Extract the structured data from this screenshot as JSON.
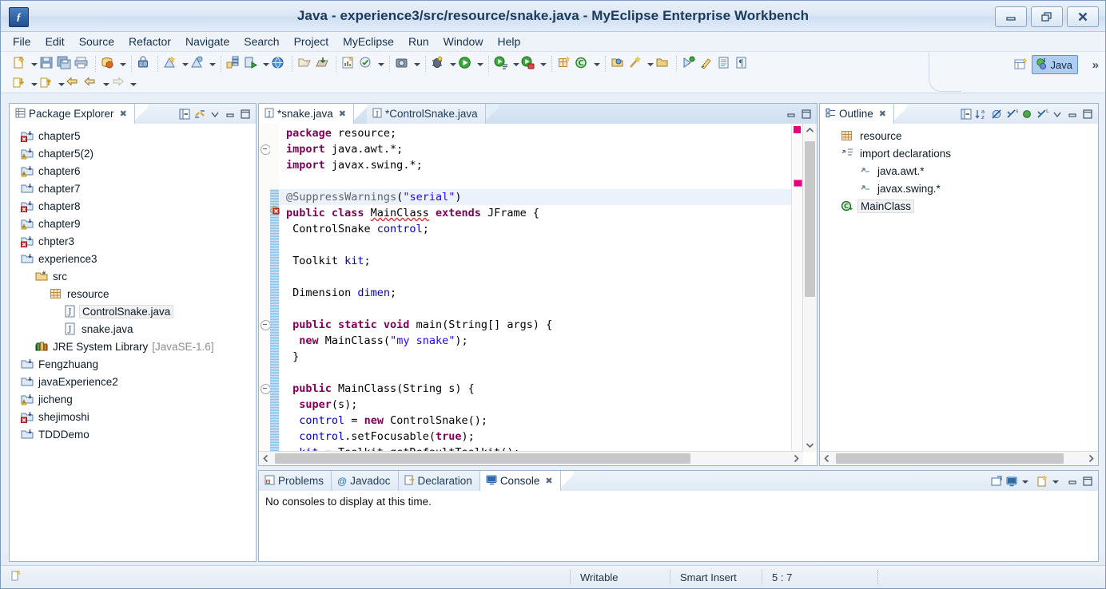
{
  "window": {
    "title": "Java - experience3/src/resource/snake.java - MyEclipse Enterprise Workbench",
    "app_icon": "myeclipse-icon",
    "minimize_label": "Minimize",
    "restore_label": "Restore",
    "close_label": "Close"
  },
  "menubar": {
    "items": [
      {
        "label": "File"
      },
      {
        "label": "Edit"
      },
      {
        "label": "Source"
      },
      {
        "label": "Refactor"
      },
      {
        "label": "Navigate"
      },
      {
        "label": "Search"
      },
      {
        "label": "Project"
      },
      {
        "label": "MyEclipse"
      },
      {
        "label": "Run"
      },
      {
        "label": "Window"
      },
      {
        "label": "Help"
      }
    ]
  },
  "toolbar": {
    "row1_groups": [
      {
        "icons": [
          "new-wizard-icon"
        ],
        "dropdown": true
      },
      {
        "icons": [
          "save-icon",
          "save-all-icon",
          "print-icon"
        ],
        "dropdown": false
      },
      {
        "icons": [
          "myeclipse-db-icon"
        ],
        "dropdown": true
      },
      {
        "icons": [
          "lock-calendar-icon"
        ],
        "dropdown": false
      },
      {
        "icons": [
          "deploy-icon"
        ],
        "dropdown": true,
        "icons2": [
          "deploy-alt-icon"
        ],
        "dropdown2": true
      },
      {
        "icons": [
          "server-stack-icon",
          "server-run-icon"
        ],
        "dropdown": true,
        "icons3": [
          "globe-icon"
        ]
      },
      {
        "icons": [
          "export-icon",
          "import-icon"
        ],
        "dropdown": false
      },
      {
        "icons": [
          "report-icon",
          "validate-icon"
        ],
        "dropdown": true
      },
      {
        "icons": [
          "snapshot-icon"
        ],
        "dropdown": true
      },
      {
        "icons": [
          "debug-icon"
        ],
        "dropdown": true,
        "icons4": [
          "run-icon"
        ],
        "dropdown4": true
      },
      {
        "icons": [
          "run-config-icon"
        ],
        "dropdown": true,
        "icons5": [
          "run-secure-icon"
        ],
        "dropdown5": true
      },
      {
        "icons": [
          "new-package-icon",
          "new-class-icon"
        ],
        "dropdown": true
      },
      {
        "icons": [
          "open-type-icon",
          "search-wand-icon"
        ],
        "dropdown": true,
        "icons6": [
          "open-resource-icon"
        ]
      },
      {
        "icons": [
          "next-annotation-icon",
          "brush-icon",
          "show-whitespace-icon",
          "paragraph-icon"
        ],
        "dropdown": false
      }
    ],
    "row2_groups": [
      {
        "icons": [
          "back-to-icon"
        ],
        "dropdown": true
      },
      {
        "icons": [
          "forward-to-icon"
        ],
        "dropdown": true
      },
      {
        "icons": [
          "prev-edit-icon",
          "back-icon"
        ],
        "dropdown": true
      },
      {
        "icons": [
          "forward-nav-icon"
        ],
        "dropdown": true
      }
    ],
    "perspective": {
      "open_perspective_icon": "open-perspective-icon",
      "active_label": "Java",
      "active_icon": "java-perspective-icon",
      "overflow_label": "»"
    }
  },
  "package_explorer": {
    "tab_label": "Package Explorer",
    "tab_icon": "package-explorer-icon",
    "close_icon": "close-icon",
    "tools": [
      {
        "name": "collapse-all-icon"
      },
      {
        "name": "link-with-editor-icon"
      },
      {
        "name": "view-menu-icon"
      },
      {
        "name": "minimize-icon"
      },
      {
        "name": "maximize-icon"
      }
    ],
    "tree": [
      {
        "label": "chapter5",
        "indent": 0,
        "icon": "java-project-error-icon"
      },
      {
        "label": "chapter5(2)",
        "indent": 0,
        "icon": "java-project-warning-icon"
      },
      {
        "label": "chapter6",
        "indent": 0,
        "icon": "java-project-warning-icon"
      },
      {
        "label": "chapter7",
        "indent": 0,
        "icon": "java-project-icon"
      },
      {
        "label": "chapter8",
        "indent": 0,
        "icon": "java-project-error-icon"
      },
      {
        "label": "chapter9",
        "indent": 0,
        "icon": "java-project-warning-icon"
      },
      {
        "label": "chpter3",
        "indent": 0,
        "icon": "java-project-error-icon"
      },
      {
        "label": "experience3",
        "indent": 0,
        "icon": "java-project-icon"
      },
      {
        "label": "src",
        "indent": 1,
        "icon": "source-folder-icon"
      },
      {
        "label": "resource",
        "indent": 2,
        "icon": "package-icon"
      },
      {
        "label": "ControlSnake.java",
        "indent": 3,
        "icon": "java-file-icon",
        "selected": true
      },
      {
        "label": "snake.java",
        "indent": 3,
        "icon": "java-file-icon"
      },
      {
        "label": "JRE System Library",
        "indent": 1,
        "icon": "library-icon",
        "suffix": "[JavaSE-1.6]"
      },
      {
        "label": "Fengzhuang",
        "indent": 0,
        "icon": "java-project-icon"
      },
      {
        "label": "javaExperience2",
        "indent": 0,
        "icon": "java-project-icon"
      },
      {
        "label": "jicheng",
        "indent": 0,
        "icon": "java-project-warning-icon"
      },
      {
        "label": "shejimoshi",
        "indent": 0,
        "icon": "java-project-error-icon"
      },
      {
        "label": "TDDDemo",
        "indent": 0,
        "icon": "java-project-icon"
      }
    ]
  },
  "editor": {
    "tabs": [
      {
        "label": "*snake.java",
        "icon": "java-file-icon",
        "active": true,
        "closeable": true
      },
      {
        "label": "*ControlSnake.java",
        "icon": "java-file-icon",
        "active": false,
        "closeable": false
      }
    ],
    "tools": [
      {
        "name": "minimize-icon"
      },
      {
        "name": "maximize-icon"
      }
    ],
    "lines": [
      {
        "n": 1,
        "fold": false,
        "hl": false,
        "change": false,
        "tokens": [
          {
            "t": "package",
            "c": "kw"
          },
          {
            "t": " resource;",
            "c": "plain"
          }
        ]
      },
      {
        "n": 2,
        "fold": true,
        "hl": false,
        "change": false,
        "tokens": [
          {
            "t": "import",
            "c": "kw"
          },
          {
            "t": " java.awt.*;",
            "c": "plain"
          }
        ]
      },
      {
        "n": 3,
        "fold": false,
        "hl": false,
        "change": false,
        "tokens": [
          {
            "t": "import",
            "c": "kw"
          },
          {
            "t": " javax.swing.*;",
            "c": "plain"
          }
        ]
      },
      {
        "n": 4,
        "fold": false,
        "hl": false,
        "change": false,
        "tokens": []
      },
      {
        "n": 5,
        "fold": false,
        "hl": true,
        "change": true,
        "tokens": [
          {
            "t": "@SuppressWarnings",
            "c": "ann"
          },
          {
            "t": "(",
            "c": "plain"
          },
          {
            "t": "\"serial\"",
            "c": "str"
          },
          {
            "t": ")",
            "c": "plain"
          }
        ]
      },
      {
        "n": 6,
        "fold": false,
        "hl": false,
        "change": true,
        "error": true,
        "tokens": [
          {
            "t": "public class ",
            "c": "kw"
          },
          {
            "t": "MainClass",
            "c": "sq"
          },
          {
            "t": " ",
            "c": "plain"
          },
          {
            "t": "extends",
            "c": "kw"
          },
          {
            "t": " JFrame {",
            "c": "plain"
          }
        ]
      },
      {
        "n": 7,
        "fold": false,
        "hl": false,
        "change": true,
        "tokens": [
          {
            "t": " ControlSnake ",
            "c": "plain"
          },
          {
            "t": "control",
            "c": "fld"
          },
          {
            "t": ";",
            "c": "plain"
          }
        ]
      },
      {
        "n": 8,
        "fold": false,
        "hl": false,
        "change": true,
        "tokens": []
      },
      {
        "n": 9,
        "fold": false,
        "hl": false,
        "change": true,
        "tokens": [
          {
            "t": " Toolkit ",
            "c": "plain"
          },
          {
            "t": "kit",
            "c": "fld"
          },
          {
            "t": ";",
            "c": "plain"
          }
        ]
      },
      {
        "n": 10,
        "fold": false,
        "hl": false,
        "change": true,
        "tokens": []
      },
      {
        "n": 11,
        "fold": false,
        "hl": false,
        "change": true,
        "tokens": [
          {
            "t": " Dimension ",
            "c": "plain"
          },
          {
            "t": "dimen",
            "c": "fld"
          },
          {
            "t": ";",
            "c": "plain"
          }
        ]
      },
      {
        "n": 12,
        "fold": false,
        "hl": false,
        "change": true,
        "tokens": []
      },
      {
        "n": 13,
        "fold": true,
        "hl": false,
        "change": true,
        "tokens": [
          {
            "t": " public static void ",
            "c": "kw"
          },
          {
            "t": "main(String[] args) {",
            "c": "plain"
          }
        ]
      },
      {
        "n": 14,
        "fold": false,
        "hl": false,
        "change": true,
        "tokens": [
          {
            "t": "  new ",
            "c": "kw"
          },
          {
            "t": "MainClass(",
            "c": "plain"
          },
          {
            "t": "\"my snake\"",
            "c": "str"
          },
          {
            "t": ");",
            "c": "plain"
          }
        ]
      },
      {
        "n": 15,
        "fold": false,
        "hl": false,
        "change": true,
        "tokens": [
          {
            "t": " }",
            "c": "plain"
          }
        ]
      },
      {
        "n": 16,
        "fold": false,
        "hl": false,
        "change": true,
        "tokens": []
      },
      {
        "n": 17,
        "fold": true,
        "hl": false,
        "change": true,
        "tokens": [
          {
            "t": " public ",
            "c": "kw"
          },
          {
            "t": "MainClass(String s) {",
            "c": "plain"
          }
        ]
      },
      {
        "n": 18,
        "fold": false,
        "hl": false,
        "change": true,
        "tokens": [
          {
            "t": "  super",
            "c": "kw"
          },
          {
            "t": "(s);",
            "c": "plain"
          }
        ]
      },
      {
        "n": 19,
        "fold": false,
        "hl": false,
        "change": true,
        "tokens": [
          {
            "t": "  ",
            "c": "plain"
          },
          {
            "t": "control",
            "c": "fld"
          },
          {
            "t": " = ",
            "c": "plain"
          },
          {
            "t": "new",
            "c": "kw"
          },
          {
            "t": " ControlSnake();",
            "c": "plain"
          }
        ]
      },
      {
        "n": 20,
        "fold": false,
        "hl": false,
        "change": true,
        "tokens": [
          {
            "t": "  ",
            "c": "plain"
          },
          {
            "t": "control",
            "c": "fld"
          },
          {
            "t": ".setFocusable(",
            "c": "plain"
          },
          {
            "t": "true",
            "c": "kw"
          },
          {
            "t": ");",
            "c": "plain"
          }
        ]
      },
      {
        "n": 21,
        "fold": false,
        "hl": false,
        "change": true,
        "clipped": true,
        "tokens": [
          {
            "t": "  ",
            "c": "plain"
          },
          {
            "t": "kit",
            "c": "fld"
          },
          {
            "t": " = Toolkit.",
            "c": "plain"
          },
          {
            "t": "getDefaultToolkit",
            "c": "plain"
          },
          {
            "t": "();",
            "c": "plain"
          }
        ]
      }
    ],
    "overview_markers": [
      {
        "name": "error-marker",
        "color": "#e6007e",
        "top_pct": 1
      },
      {
        "name": "error-marker",
        "color": "#e6007e",
        "top_pct": 17
      }
    ]
  },
  "outline": {
    "tab_label": "Outline",
    "tab_icon": "outline-icon",
    "close_icon": "close-icon",
    "tools": [
      {
        "name": "collapse-all-icon"
      },
      {
        "name": "sort-icon"
      },
      {
        "name": "hide-fields-icon"
      },
      {
        "name": "hide-static-icon"
      },
      {
        "name": "hide-nonpublic-icon"
      },
      {
        "name": "hide-local-types-icon"
      },
      {
        "name": "view-menu-icon"
      },
      {
        "name": "minimize-icon"
      },
      {
        "name": "maximize-icon"
      }
    ],
    "tree": [
      {
        "label": "resource",
        "indent": 0,
        "icon": "package-icon"
      },
      {
        "label": "import declarations",
        "indent": 0,
        "icon": "import-declarations-icon"
      },
      {
        "label": "java.awt.*",
        "indent": 1,
        "icon": "import-icon"
      },
      {
        "label": "javax.swing.*",
        "indent": 1,
        "icon": "import-icon"
      },
      {
        "label": "MainClass",
        "indent": 0,
        "icon": "class-icon",
        "selected": true
      }
    ]
  },
  "bottom_panel": {
    "tabs": [
      {
        "label": "Problems",
        "icon": "problems-icon",
        "active": false,
        "closeable": false
      },
      {
        "label": "Javadoc",
        "icon": "javadoc-icon",
        "active": false,
        "closeable": false
      },
      {
        "label": "Declaration",
        "icon": "declaration-icon",
        "active": false,
        "closeable": false
      },
      {
        "label": "Console",
        "icon": "console-icon",
        "active": true,
        "closeable": true
      }
    ],
    "tools": [
      {
        "name": "open-console-icon"
      },
      {
        "name": "display-selected-console-icon"
      },
      {
        "name": "display-selected-console-dropdown-icon"
      },
      {
        "name": "new-console-view-icon"
      },
      {
        "name": "new-console-view-dropdown-icon"
      },
      {
        "name": "minimize-icon"
      },
      {
        "name": "maximize-icon"
      }
    ],
    "content": "No consoles to display at this time."
  },
  "statusbar": {
    "left_icon": "smart-insert-status-icon",
    "writable": "Writable",
    "insert_mode": "Smart Insert",
    "cursor_position": "5 : 7"
  },
  "colors": {
    "keyword": "#7f0055",
    "string": "#2a00ff",
    "annotation": "#646464",
    "field": "#0000c0",
    "selection": "#aecdf0",
    "error_marker": "#e6007e",
    "change_bar": "#8dbfe6",
    "titlebar": "#dde8f5"
  }
}
